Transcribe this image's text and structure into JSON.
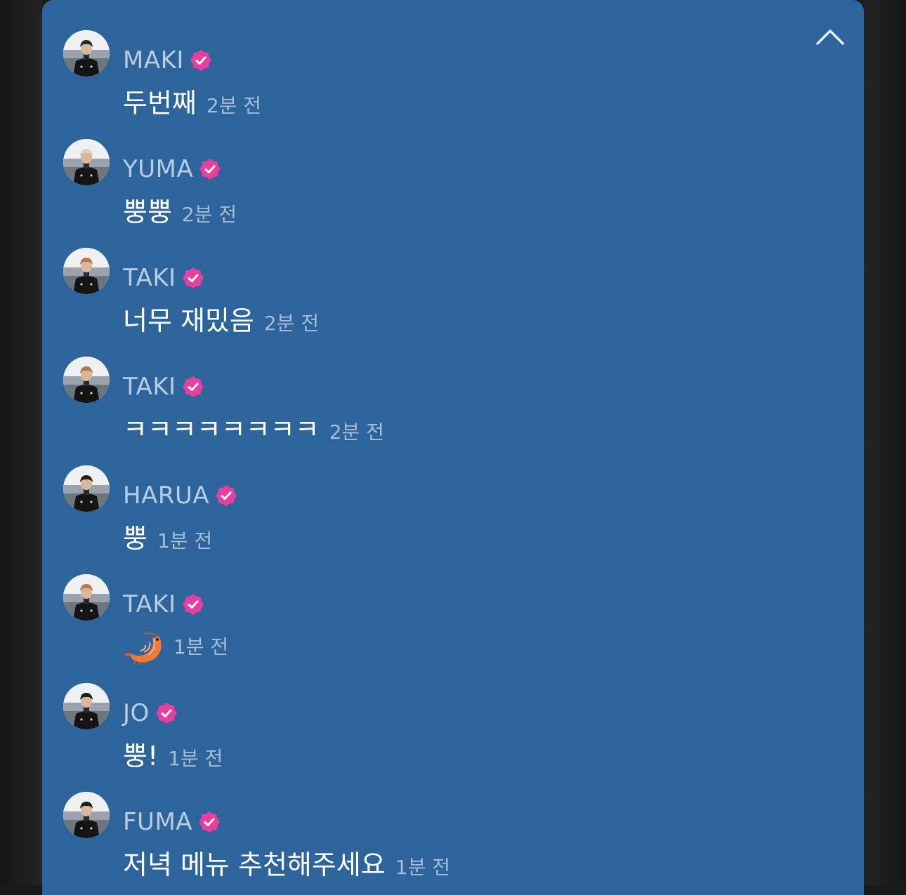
{
  "colors": {
    "panel": "#2d649b",
    "username": "#b8cce2",
    "message": "#ffffff",
    "timestamp": "#a7bdd7",
    "badge": "#e83e9f"
  },
  "header": {
    "collapse_icon": "chevron-up-icon"
  },
  "messages": [
    {
      "user": "MAKI",
      "text": "두번째",
      "time": "2분 전",
      "avatar_hair": "#2a2a2a"
    },
    {
      "user": "YUMA",
      "text": "뿡뿡",
      "time": "2분 전",
      "avatar_hair": "#d8d2b8"
    },
    {
      "user": "TAKI",
      "text": "너무 재밌음",
      "time": "2분 전",
      "avatar_hair": "#b07a4a"
    },
    {
      "user": "TAKI",
      "text": "ㅋㅋㅋㅋㅋㅋㅋㅋ",
      "time": "2분 전",
      "avatar_hair": "#b07a4a"
    },
    {
      "user": "HARUA",
      "text": "뿡",
      "time": "1분 전",
      "avatar_hair": "#1c1c1c"
    },
    {
      "user": "TAKI",
      "text": "",
      "emoji": "shrimp-emoji",
      "time": "1분 전",
      "avatar_hair": "#b07a4a"
    },
    {
      "user": "JO",
      "text": "뿡!",
      "time": "1분 전",
      "avatar_hair": "#1c1c1c"
    },
    {
      "user": "FUMA",
      "text": "저녁 메뉴 추천해주세요",
      "time": "1분 전",
      "avatar_hair": "#1c1c1c"
    }
  ]
}
